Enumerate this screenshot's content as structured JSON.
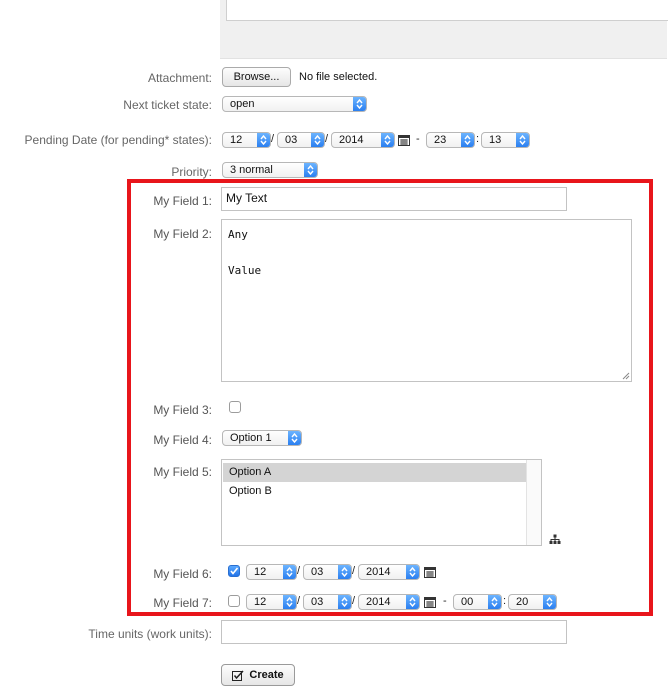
{
  "form": {
    "attachment": {
      "label": "Attachment:",
      "button": "Browse...",
      "status": "No file selected."
    },
    "next_state": {
      "label": "Next ticket state:",
      "value": "open"
    },
    "pending": {
      "label": "Pending Date (for pending* states):",
      "day": "12",
      "month": "03",
      "year": "2014",
      "hour": "23",
      "minute": "13",
      "sep_slash": "/",
      "sep_dash": "-",
      "sep_colon": ":"
    },
    "priority": {
      "label": "Priority:",
      "value": "3 normal"
    },
    "field1": {
      "label": "My Field 1:",
      "value": "My Text"
    },
    "field2": {
      "label": "My Field 2:",
      "lines": [
        "Any",
        "",
        "Value"
      ]
    },
    "field3": {
      "label": "My Field 3:",
      "checked": false
    },
    "field4": {
      "label": "My Field 4:",
      "value": "Option 1"
    },
    "field5": {
      "label": "My Field 5:",
      "options": [
        "Option A",
        "Option B"
      ],
      "selected": "Option A"
    },
    "field6": {
      "label": "My Field 6:",
      "checked": true,
      "day": "12",
      "month": "03",
      "year": "2014"
    },
    "field7": {
      "label": "My Field 7:",
      "checked": false,
      "day": "12",
      "month": "03",
      "year": "2014",
      "hour": "00",
      "minute": "20"
    },
    "time_units": {
      "label": "Time units (work units):",
      "value": ""
    },
    "create_button": "Create"
  },
  "colors": {
    "highlight": "#e8151b",
    "select_accent": "#2b7ff0"
  }
}
